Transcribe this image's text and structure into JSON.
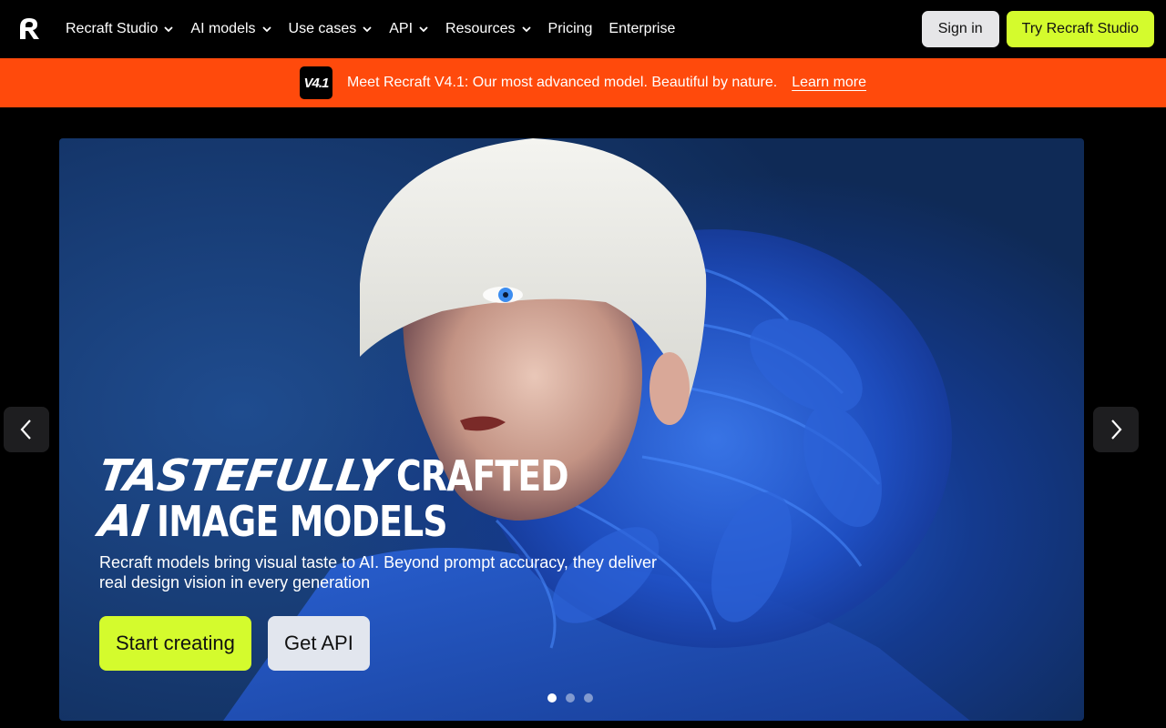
{
  "nav": {
    "items": [
      {
        "label": "Recraft Studio",
        "dropdown": true
      },
      {
        "label": "AI models",
        "dropdown": true
      },
      {
        "label": "Use cases",
        "dropdown": true
      },
      {
        "label": "API",
        "dropdown": true
      },
      {
        "label": "Resources",
        "dropdown": true
      },
      {
        "label": "Pricing",
        "dropdown": false
      },
      {
        "label": "Enterprise",
        "dropdown": false
      }
    ],
    "sign_in": "Sign in",
    "try_studio": "Try Recraft Studio"
  },
  "banner": {
    "badge": "V4.1",
    "text": "Meet Recraft V4.1: Our most advanced model. Beautiful by nature.",
    "link": "Learn more"
  },
  "hero": {
    "headline_line1_italic": "TASTEFULLY",
    "headline_line1_cond": "CRAFTED",
    "headline_line2_italic": "AI",
    "headline_line2_cond": "IMAGE MODELS",
    "subtext": "Recraft models bring visual taste to AI. Beyond prompt accuracy, they deliver real design vision in every generation",
    "start_button": "Start creating",
    "api_button": "Get API",
    "slides": 3,
    "active_slide": 0
  },
  "colors": {
    "accent_lime": "#d4fb2d",
    "banner_orange": "#ff4a0c",
    "background": "#000000"
  },
  "icons": [
    "recraft-logo",
    "chevron-down-icon",
    "chevron-left-icon",
    "chevron-right-icon"
  ]
}
